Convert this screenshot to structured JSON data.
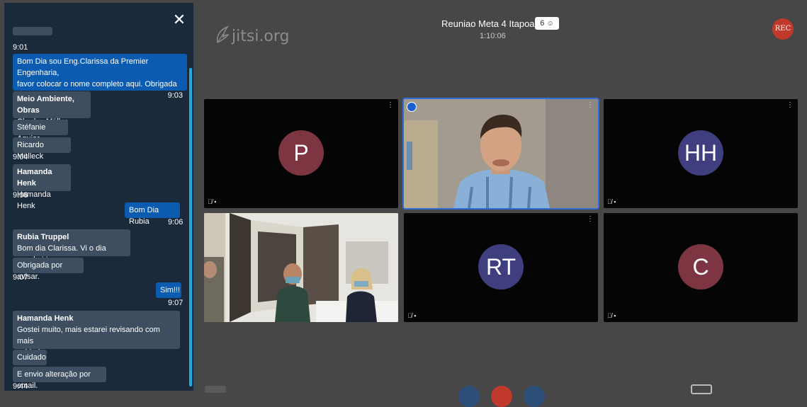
{
  "chat": {
    "close_icon": "close-icon",
    "messages": [
      {
        "type": "time",
        "text": "9:01"
      },
      {
        "type": "out",
        "lines": [
          "Bom Dia sou Eng.Clarissa da Premier Engenharia,",
          "favor colocar o nome completo aqui. Obrigada"
        ],
        "time": "9:03"
      },
      {
        "type": "in",
        "name": "Meio Ambiente, Obras",
        "lines": [
          "Charles Müller"
        ]
      },
      {
        "type": "in",
        "lines": [
          "Stéfanie Aguiar"
        ]
      },
      {
        "type": "in",
        "lines": [
          "Ricardo Mülleck"
        ],
        "time": "9:04"
      },
      {
        "type": "in",
        "name": "Hamanda Henk",
        "lines": [
          "Hamanda Henk"
        ],
        "time": "9:06"
      },
      {
        "type": "out",
        "lines": [
          "Bom Dia Rubia"
        ],
        "time": "9:06"
      },
      {
        "type": "in",
        "name": "Rubia Truppel",
        "lines": [
          "Bom dia Clarissa. Vi o dia errado"
        ],
        "cursor": "| |"
      },
      {
        "type": "in",
        "lines": [
          "Obrigada por avisar."
        ],
        "time": "9:07"
      },
      {
        "type": "out",
        "lines": [
          "Sim!!!"
        ],
        "time": "9:07"
      },
      {
        "type": "in",
        "name": "Hamanda Henk",
        "lines": [
          "Gostei muito, mais estarei revisando com mais",
          "cuidade"
        ]
      },
      {
        "type": "in",
        "lines": [
          "Cuidado"
        ]
      },
      {
        "type": "in",
        "lines": [
          "E envio alteração por email."
        ],
        "time": "9:44"
      }
    ]
  },
  "header": {
    "logo_text": "jitsi.org",
    "meeting_title": "Reuniao Meta 4 Itapoa",
    "participant_count": "6",
    "participants_icon": "participants-icon",
    "timer": "1:10:06",
    "rec_label": "REC"
  },
  "tiles": [
    {
      "id": "p",
      "initials": "P",
      "avatar_color": "#7c3541",
      "muted": true
    },
    {
      "id": "speaker",
      "initials": "",
      "video": true,
      "active": true
    },
    {
      "id": "hh",
      "initials": "HH",
      "avatar_color": "#3f3f80",
      "muted": true
    },
    {
      "id": "room",
      "initials": "",
      "video": true
    },
    {
      "id": "rt",
      "initials": "RT",
      "avatar_color": "#3f3f80",
      "muted": true
    },
    {
      "id": "c",
      "initials": "C",
      "avatar_color": "#7c3541",
      "muted": true
    }
  ],
  "colors": {
    "accent": "#0b5bb0",
    "rec": "#c0392b",
    "chat_bg": "#1b2a3b"
  }
}
